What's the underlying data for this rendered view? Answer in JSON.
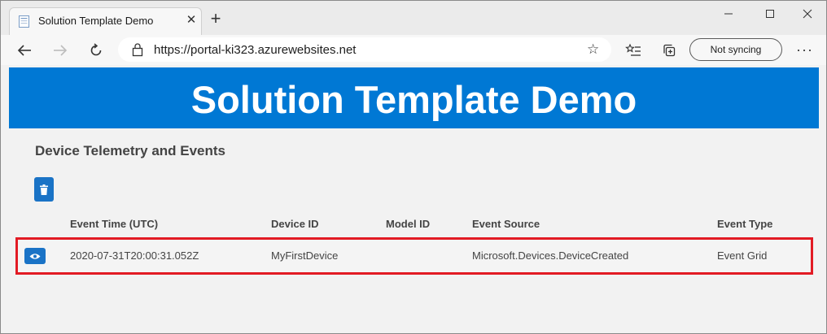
{
  "browser": {
    "tab_title": "Solution Template Demo",
    "url": "https://portal-ki323.azurewebsites.net",
    "sync_label": "Not syncing"
  },
  "page": {
    "banner_title": "Solution Template Demo",
    "section_title": "Device Telemetry and Events",
    "table": {
      "columns": [
        "Event Time (UTC)",
        "Device ID",
        "Model ID",
        "Event Source",
        "Event Type"
      ],
      "rows": [
        {
          "event_time": "2020-07-31T20:00:31.052Z",
          "device_id": "MyFirstDevice",
          "model_id": "",
          "event_source": "Microsoft.Devices.DeviceCreated",
          "event_type": "Event Grid"
        }
      ]
    }
  },
  "colors": {
    "banner": "#0078d4",
    "button": "#1a73c6",
    "highlight": "#e21b24"
  }
}
